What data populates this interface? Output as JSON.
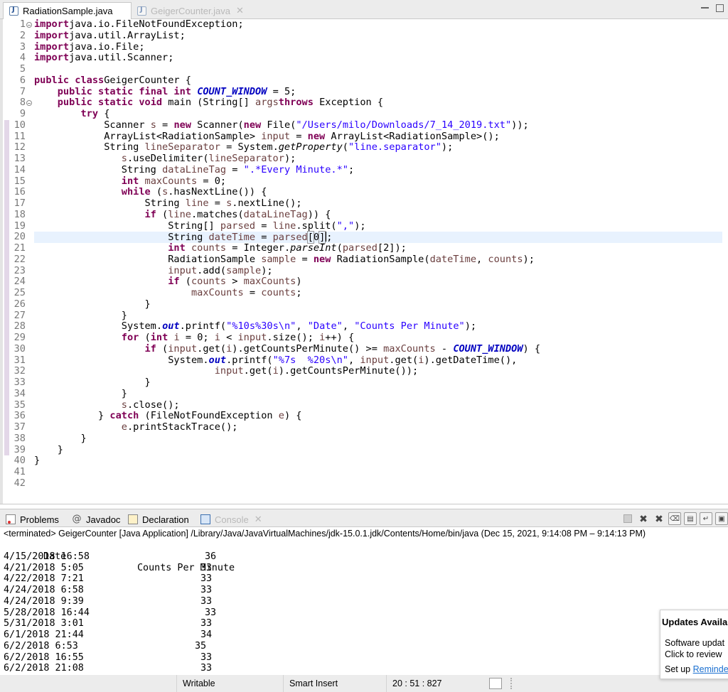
{
  "editor_tabs": [
    {
      "label": "RadiationSample.java"
    },
    {
      "label": "GeigerCounter.java"
    }
  ],
  "code_lines": [
    {
      "n": "1",
      "tokens": [
        [
          "kw",
          "import"
        ],
        [
          "",
          "java.io.FileNotFoundException;"
        ]
      ]
    },
    {
      "n": "2",
      "tokens": [
        [
          "kw",
          "import"
        ],
        [
          "",
          "java.util.ArrayList;"
        ]
      ]
    },
    {
      "n": "3",
      "tokens": [
        [
          "kw",
          "import"
        ],
        [
          "",
          "java.io.File;"
        ]
      ]
    },
    {
      "n": "4",
      "tokens": [
        [
          "kw",
          "import"
        ],
        [
          "",
          "java.util.Scanner;"
        ]
      ]
    },
    {
      "n": "5",
      "tokens": []
    },
    {
      "n": "6",
      "tokens": [
        [
          "kw",
          "public"
        ],
        [
          "",
          " "
        ],
        [
          "kw",
          "class"
        ],
        [
          "",
          "",
          " "
        ],
        [
          "",
          "GeigerCounter {"
        ]
      ]
    },
    {
      "n": "7",
      "tokens": [
        [
          "",
          "    "
        ],
        [
          "kw",
          "public static final int"
        ],
        [
          "",
          " "
        ],
        [
          "fld",
          "COUNT_WINDOW"
        ],
        [
          "",
          " = 5;"
        ]
      ]
    },
    {
      "n": "8",
      "tokens": [
        [
          "",
          "    "
        ],
        [
          "kw",
          "public static void"
        ],
        [
          "",
          " main (String[] "
        ],
        [
          "lv",
          "args"
        ],
        [
          ") "
        ],
        [
          "kw",
          "throws"
        ],
        [
          "",
          " Exception {"
        ]
      ]
    },
    {
      "n": "9",
      "tokens": [
        [
          "",
          "        "
        ],
        [
          "kw",
          "try"
        ],
        [
          "",
          " {"
        ]
      ]
    },
    {
      "n": "10",
      "tokens": [
        [
          "",
          "            Scanner "
        ],
        [
          "lv",
          "s"
        ],
        [
          "",
          " = "
        ],
        [
          "kw",
          "new"
        ],
        [
          "",
          " Scanner("
        ],
        [
          "kw",
          "new"
        ],
        [
          "",
          " File("
        ],
        [
          "str",
          "\"/Users/milo/Downloads/7_14_2019.txt\""
        ],
        [
          "",
          "));"
        ]
      ]
    },
    {
      "n": "11",
      "tokens": [
        [
          "",
          "            ArrayList<RadiationSample> "
        ],
        [
          "lv",
          "input"
        ],
        [
          "",
          " = "
        ],
        [
          "kw",
          "new"
        ],
        [
          "",
          " ArrayList<RadiationSample>();"
        ]
      ]
    },
    {
      "n": "12",
      "tokens": [
        [
          "",
          "            String "
        ],
        [
          "lv",
          "lineSeparator"
        ],
        [
          "",
          " = System."
        ],
        [
          "it",
          "getProperty"
        ],
        [
          "",
          "("
        ],
        [
          "str",
          "\"line.separator\""
        ],
        [
          "",
          ");"
        ]
      ]
    },
    {
      "n": "13",
      "tokens": [
        [
          "",
          "               "
        ],
        [
          "lv",
          "s"
        ],
        [
          "",
          ".useDelimiter("
        ],
        [
          "lv",
          "lineSeparator"
        ],
        [
          "",
          ");"
        ]
      ]
    },
    {
      "n": "14",
      "tokens": [
        [
          "",
          "               String "
        ],
        [
          "lv",
          "dataLineTag"
        ],
        [
          "",
          " = "
        ],
        [
          "str",
          "\".*Every Minute.*\""
        ],
        [
          "",
          ";"
        ]
      ]
    },
    {
      "n": "15",
      "tokens": [
        [
          "",
          "               "
        ],
        [
          "kw",
          "int"
        ],
        [
          "",
          " "
        ],
        [
          "lv",
          "maxCounts"
        ],
        [
          "",
          " = 0;"
        ]
      ]
    },
    {
      "n": "16",
      "tokens": [
        [
          "",
          "               "
        ],
        [
          "kw",
          "while"
        ],
        [
          "",
          " ("
        ],
        [
          "lv",
          "s"
        ],
        [
          "",
          ".hasNextLine()) {"
        ]
      ]
    },
    {
      "n": "17",
      "tokens": [
        [
          "",
          "                   String "
        ],
        [
          "lv",
          "line"
        ],
        [
          "",
          " = "
        ],
        [
          "lv",
          "s"
        ],
        [
          "",
          ".nextLine();"
        ]
      ]
    },
    {
      "n": "18",
      "tokens": [
        [
          "",
          "                   "
        ],
        [
          "kw",
          "if"
        ],
        [
          "",
          " ("
        ],
        [
          "lv",
          "line"
        ],
        [
          "",
          ".matches("
        ],
        [
          "lv",
          "dataLineTag"
        ],
        [
          "",
          ")) {"
        ]
      ]
    },
    {
      "n": "19",
      "tokens": [
        [
          "",
          "                       String[] "
        ],
        [
          "lv",
          "parsed"
        ],
        [
          "",
          " = "
        ],
        [
          "lv",
          "line"
        ],
        [
          "",
          ".split("
        ],
        [
          "str",
          "\",\""
        ],
        [
          "",
          ");"
        ]
      ]
    },
    {
      "n": "20",
      "hl": true,
      "tokens": [
        [
          "",
          "                       String "
        ],
        [
          "lv",
          "dateTime"
        ],
        [
          "",
          " = "
        ],
        [
          "lv",
          "parsed"
        ],
        [
          "bracket",
          "["
        ],
        [
          "",
          "0"
        ],
        [
          "bracket",
          "]"
        ],
        [
          "cursor",
          ""
        ],
        [
          "",
          ";"
        ]
      ]
    },
    {
      "n": "21",
      "tokens": [
        [
          "",
          "                       "
        ],
        [
          "kw",
          "int"
        ],
        [
          "",
          " "
        ],
        [
          "lv",
          "counts"
        ],
        [
          "",
          " = Integer."
        ],
        [
          "it",
          "parseInt"
        ],
        [
          "",
          "("
        ],
        [
          "lv",
          "parsed"
        ],
        [
          "",
          "[2]);"
        ]
      ]
    },
    {
      "n": "22",
      "tokens": [
        [
          "",
          "                       RadiationSample "
        ],
        [
          "lv",
          "sample"
        ],
        [
          "",
          " = "
        ],
        [
          "kw",
          "new"
        ],
        [
          "",
          " RadiationSample("
        ],
        [
          "lv",
          "dateTime"
        ],
        [
          "",
          ", "
        ],
        [
          "lv",
          "counts"
        ],
        [
          "",
          ");"
        ]
      ]
    },
    {
      "n": "23",
      "tokens": [
        [
          "",
          "                       "
        ],
        [
          "lv",
          "input"
        ],
        [
          "",
          ".add("
        ],
        [
          "lv",
          "sample"
        ],
        [
          "",
          ");"
        ]
      ]
    },
    {
      "n": "24",
      "tokens": [
        [
          "",
          "                       "
        ],
        [
          "kw",
          "if"
        ],
        [
          "",
          " ("
        ],
        [
          "lv",
          "counts"
        ],
        [
          "",
          " > "
        ],
        [
          "lv",
          "maxCounts"
        ],
        [
          "",
          ")"
        ]
      ]
    },
    {
      "n": "25",
      "tokens": [
        [
          "",
          "                           "
        ],
        [
          "lv",
          "maxCounts"
        ],
        [
          "",
          " = "
        ],
        [
          "lv",
          "counts"
        ],
        [
          "",
          ";"
        ]
      ]
    },
    {
      "n": "26",
      "tokens": [
        [
          "",
          "                   }"
        ]
      ]
    },
    {
      "n": "27",
      "tokens": [
        [
          "",
          "               }"
        ]
      ]
    },
    {
      "n": "28",
      "tokens": [
        [
          "",
          "               System."
        ],
        [
          "fld",
          "out"
        ],
        [
          "",
          ".printf("
        ],
        [
          "str",
          "\"%10s%30s\\n\""
        ],
        [
          "",
          ", "
        ],
        [
          "str",
          "\"Date\""
        ],
        [
          "",
          ", "
        ],
        [
          "str",
          "\"Counts Per Minute\""
        ],
        [
          "",
          ");"
        ]
      ]
    },
    {
      "n": "29",
      "tokens": [
        [
          "",
          "               "
        ],
        [
          "kw",
          "for"
        ],
        [
          "",
          " ("
        ],
        [
          "kw",
          "int"
        ],
        [
          "",
          " "
        ],
        [
          "lv",
          "i"
        ],
        [
          "",
          " = 0; "
        ],
        [
          "lv",
          "i"
        ],
        [
          "",
          " < "
        ],
        [
          "lv",
          "input"
        ],
        [
          "",
          ".size(); "
        ],
        [
          "lv",
          "i"
        ],
        [
          "",
          "++) {"
        ]
      ]
    },
    {
      "n": "30",
      "tokens": [
        [
          "",
          "                   "
        ],
        [
          "kw",
          "if"
        ],
        [
          "",
          " ("
        ],
        [
          "lv",
          "input"
        ],
        [
          "",
          ".get("
        ],
        [
          "lv",
          "i"
        ],
        [
          "",
          ").getCountsPerMinute() >= "
        ],
        [
          "lv",
          "maxCounts"
        ],
        [
          "",
          " - "
        ],
        [
          "fld",
          "COUNT_WINDOW"
        ],
        [
          "",
          ") {"
        ]
      ]
    },
    {
      "n": "31",
      "tokens": [
        [
          "",
          "                       System."
        ],
        [
          "fld",
          "out"
        ],
        [
          "",
          ".printf("
        ],
        [
          "str",
          "\"%7s  %20s\\n\""
        ],
        [
          "",
          ", "
        ],
        [
          "lv",
          "input"
        ],
        [
          "",
          ".get("
        ],
        [
          "lv",
          "i"
        ],
        [
          "",
          ").getDateTime(),"
        ]
      ]
    },
    {
      "n": "32",
      "tokens": [
        [
          "",
          "                               "
        ],
        [
          "lv",
          "input"
        ],
        [
          "",
          ".get("
        ],
        [
          "lv",
          "i"
        ],
        [
          "",
          ").getCountsPerMinute());"
        ]
      ]
    },
    {
      "n": "33",
      "tokens": [
        [
          "",
          "                   }"
        ]
      ]
    },
    {
      "n": "34",
      "tokens": [
        [
          "",
          "               }"
        ]
      ]
    },
    {
      "n": "35",
      "tokens": [
        [
          "",
          "               "
        ],
        [
          "lv",
          "s"
        ],
        [
          "",
          ".close();"
        ]
      ]
    },
    {
      "n": "36",
      "tokens": [
        [
          "",
          "           } "
        ],
        [
          "kw",
          "catch"
        ],
        [
          "",
          " (FileNotFoundException "
        ],
        [
          "lv",
          "e"
        ],
        [
          "",
          ") {"
        ]
      ]
    },
    {
      "n": "37",
      "tokens": [
        [
          "",
          "               "
        ],
        [
          "lv",
          "e"
        ],
        [
          "",
          ".printStackTrace();"
        ]
      ]
    },
    {
      "n": "38",
      "tokens": [
        [
          "",
          "        }"
        ]
      ]
    },
    {
      "n": "39",
      "tokens": [
        [
          "",
          "    }"
        ]
      ]
    },
    {
      "n": "40",
      "tokens": [
        [
          "",
          "}"
        ]
      ]
    },
    {
      "n": "41",
      "tokens": []
    },
    {
      "n": "42",
      "tokens": []
    }
  ],
  "panel_tabs": {
    "problems": "Problems",
    "javadoc": "Javadoc",
    "declaration": "Declaration",
    "console": "Console"
  },
  "console": {
    "terminated_line": "<terminated> GeigerCounter [Java Application] /Library/Java/JavaVirtualMachines/jdk-15.0.1.jdk/Contents/Home/bin/java  (Dec 15, 2021, 9:14:08 PM – 9:14:13 PM)",
    "header_date": "Date",
    "header_counts": "Counts Per Minute",
    "rows": [
      {
        "date": "4/15/2018 16:58",
        "count": "36"
      },
      {
        "date": "4/21/2018 5:05",
        "count": "33"
      },
      {
        "date": "4/22/2018 7:21",
        "count": "33"
      },
      {
        "date": "4/24/2018 6:58",
        "count": "33"
      },
      {
        "date": "4/24/2018 9:39",
        "count": "33"
      },
      {
        "date": "5/28/2018 16:44",
        "count": "33"
      },
      {
        "date": "5/31/2018 3:01",
        "count": "33"
      },
      {
        "date": "6/1/2018 21:44",
        "count": "34"
      },
      {
        "date": "6/2/2018 6:53",
        "count": "35"
      },
      {
        "date": "6/2/2018 16:55",
        "count": "33"
      },
      {
        "date": "6/2/2018 21:08",
        "count": "33"
      }
    ]
  },
  "status_bar": {
    "writable": "Writable",
    "insert_mode": "Smart Insert",
    "position": "20 : 51 : 827"
  },
  "notification": {
    "title": "Updates Availal",
    "line1": "Software updat",
    "line2": "Click to review",
    "line3_prefix": "Set up ",
    "line3_link": "Reminde"
  },
  "colors": {
    "keyword": "#7f0055",
    "string": "#2a00ff",
    "static_field": "#0000c0",
    "local_variable": "#6a3e3e",
    "current_line": "#e8f2fe"
  }
}
